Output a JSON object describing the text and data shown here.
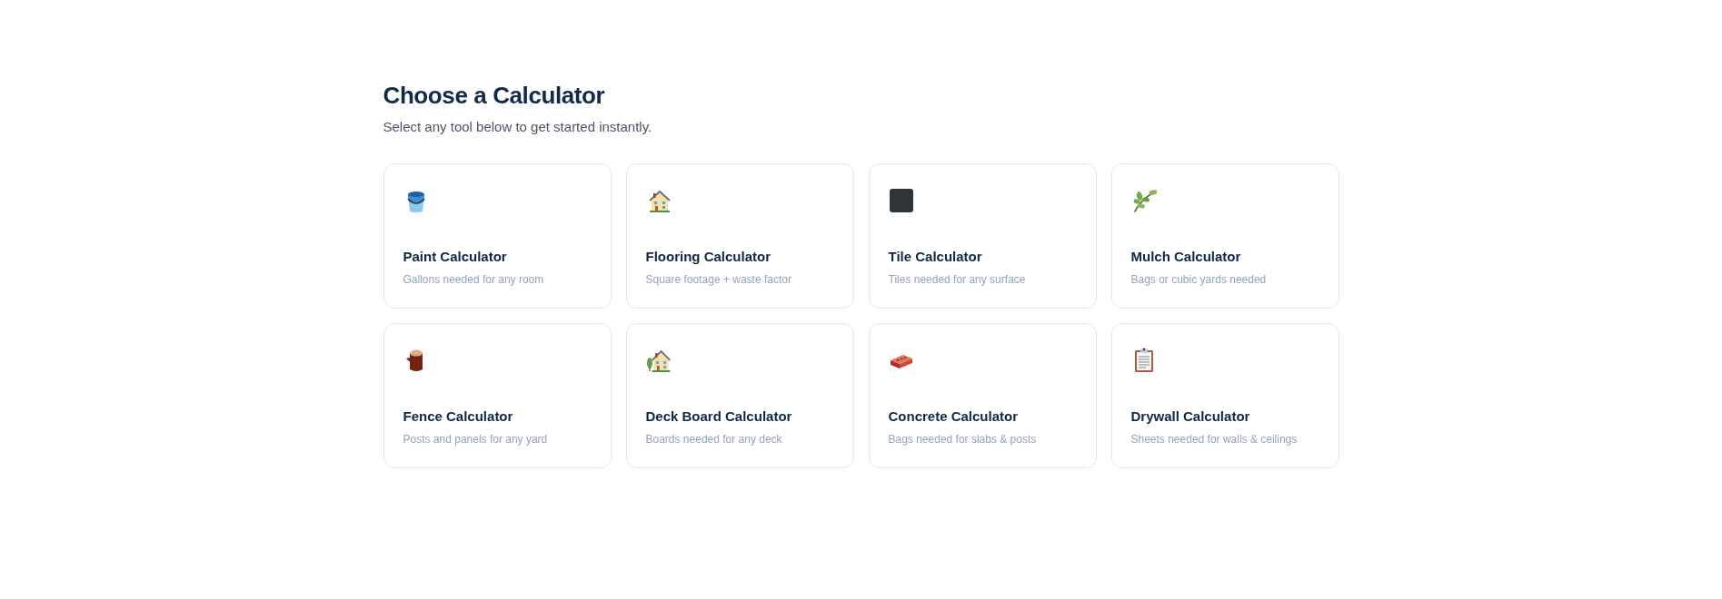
{
  "header": {
    "title": "Choose a Calculator",
    "subtitle": "Select any tool below to get started instantly."
  },
  "calculators": [
    {
      "kind": "paint",
      "title": "Paint Calculator",
      "description": "Gallons needed for any room"
    },
    {
      "kind": "flooring",
      "title": "Flooring Calculator",
      "description": "Square footage + waste factor"
    },
    {
      "kind": "tile",
      "title": "Tile Calculator",
      "description": "Tiles needed for any surface"
    },
    {
      "kind": "mulch",
      "title": "Mulch Calculator",
      "description": "Bags or cubic yards needed"
    },
    {
      "kind": "fence",
      "title": "Fence Calculator",
      "description": "Posts and panels for any yard"
    },
    {
      "kind": "deck",
      "title": "Deck Board Calculator",
      "description": "Boards needed for any deck"
    },
    {
      "kind": "concrete",
      "title": "Concrete Calculator",
      "description": "Bags needed for slabs & posts"
    },
    {
      "kind": "drywall",
      "title": "Drywall Calculator",
      "description": "Sheets needed for walls & ceilings"
    }
  ]
}
